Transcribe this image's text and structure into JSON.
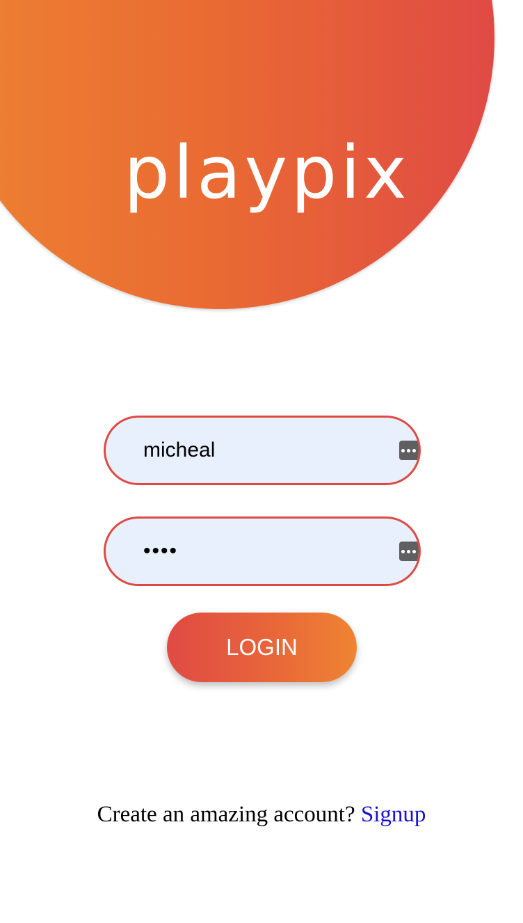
{
  "brand": {
    "logo_text": "playpix",
    "gradient_colors": [
      "#ee8231",
      "#e04a44"
    ]
  },
  "login_form": {
    "username": {
      "value": "micheal",
      "icon": "password-manager-icon"
    },
    "password": {
      "value": "abcd",
      "icon": "password-manager-icon"
    },
    "login_label": "LOGIN",
    "field_border_color": "#de4a43",
    "field_background": "#e8effd"
  },
  "footer": {
    "prompt": "Create an amazing account?",
    "signup_label": "Signup",
    "link_color": "#1a10cc"
  }
}
